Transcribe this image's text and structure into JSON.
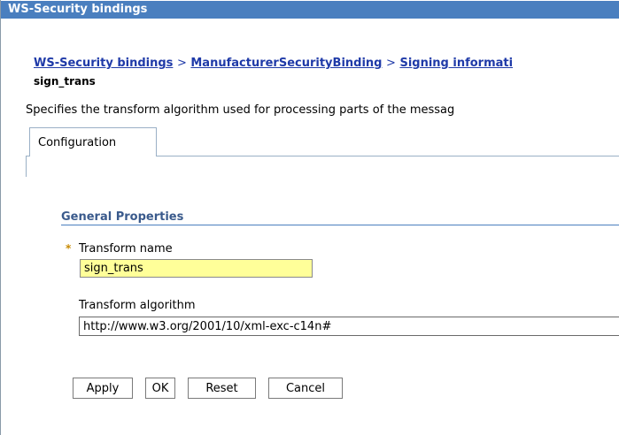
{
  "window": {
    "title": "WS-Security bindings"
  },
  "breadcrumb": {
    "items": [
      "WS-Security bindings",
      "ManufacturerSecurityBinding",
      "Signing informati"
    ],
    "separator": ">",
    "current": "sign_trans"
  },
  "description": "Specifies the transform algorithm used for processing parts of the messag",
  "tabs": [
    {
      "label": "Configuration"
    }
  ],
  "general_properties": {
    "title": "General Properties",
    "required_marker": "*",
    "transform_name": {
      "label": "Transform name",
      "value": "sign_trans"
    },
    "transform_algorithm": {
      "label": "Transform algorithm",
      "value": "http://www.w3.org/2001/10/xml-exc-c14n#"
    }
  },
  "buttons": {
    "apply": "Apply",
    "ok": "OK",
    "reset": "Reset",
    "cancel": "Cancel"
  },
  "colors": {
    "titlebar": "#4a7fbf",
    "link": "#1f3aa8",
    "section_title": "#3a5a8c",
    "required_input": "#ffff99"
  }
}
